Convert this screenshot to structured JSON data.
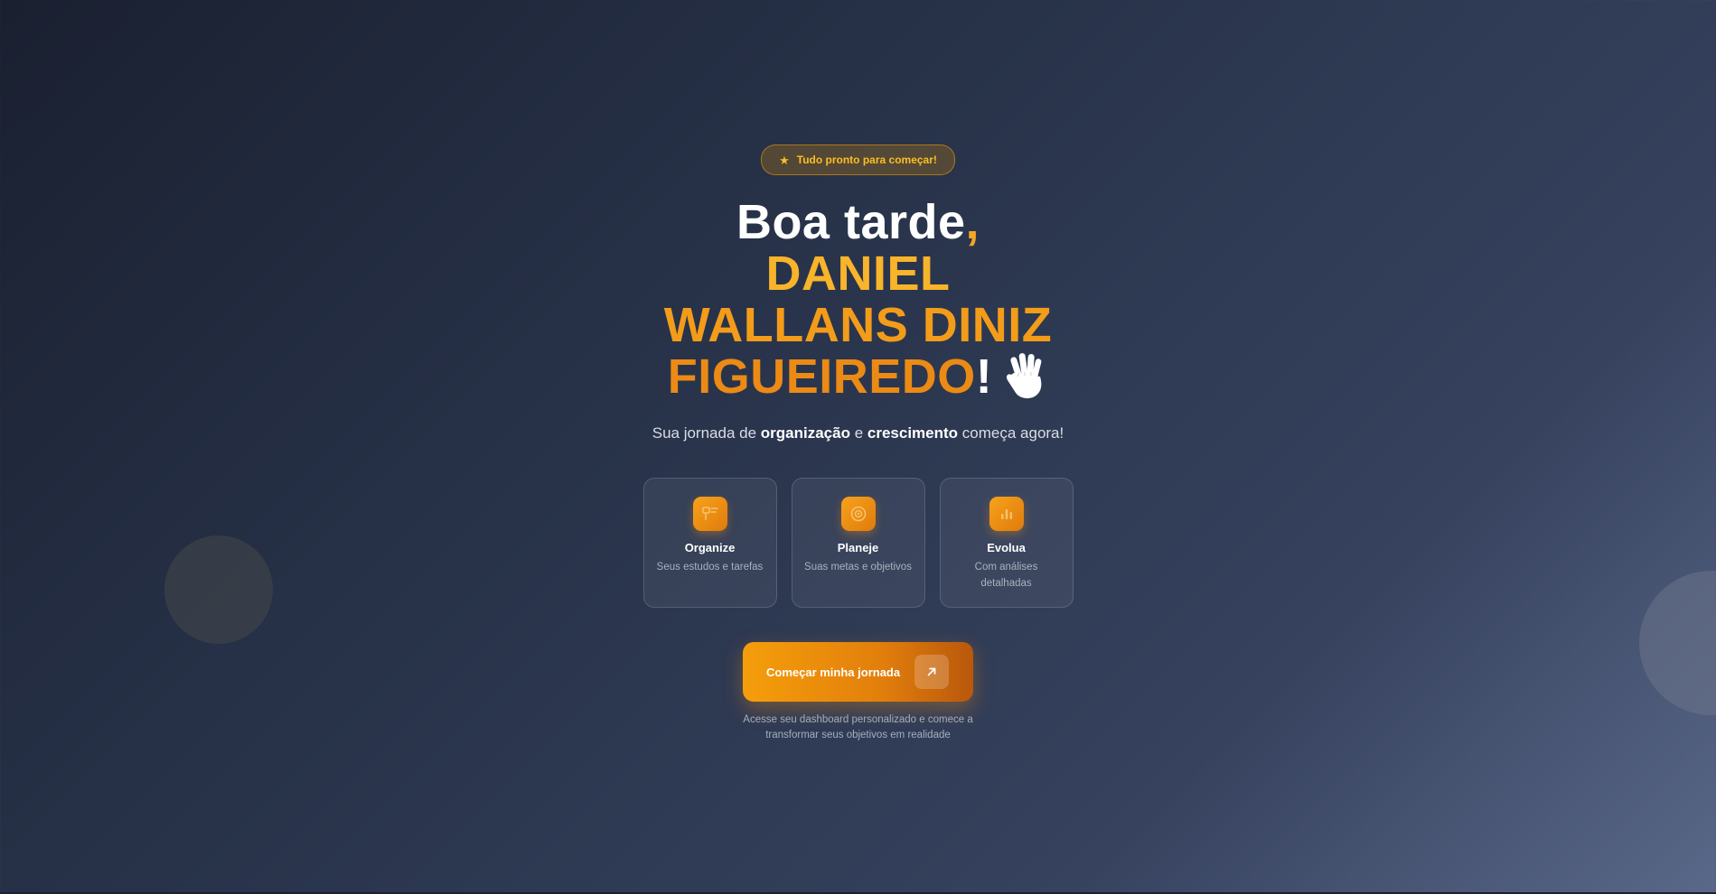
{
  "badge": {
    "icon": "star-icon",
    "text": "Tudo pronto para começar!"
  },
  "greeting": {
    "prefix": "Boa tarde",
    "comma": ",",
    "name_line_1": "DANIEL",
    "name_line_2": "WALLANS DINIZ",
    "name_line_3": "FIGUEIREDO",
    "exclamation": "!",
    "emoji_icon": "waving-hand-icon"
  },
  "subtitle": {
    "part1": "Sua jornada de ",
    "bold1": "organização",
    "part2": " e ",
    "bold2": "crescimento",
    "part3": " começa agora!"
  },
  "features": [
    {
      "icon": "organize-icon",
      "title": "Organize",
      "description": "Seus estudos e tarefas"
    },
    {
      "icon": "target-icon",
      "title": "Planeje",
      "description": "Suas metas e objetivos"
    },
    {
      "icon": "bar-chart-icon",
      "title": "Evolua",
      "description": "Com análises detalhadas"
    }
  ],
  "cta": {
    "label": "Começar minha jornada",
    "icon": "arrow-up-right-icon"
  },
  "footnote": "Acesse seu dashboard personalizado e comece a transformar seus objetivos em realidade",
  "colors": {
    "accent": "#f59e0b",
    "accent_dark": "#e07b0c",
    "badge_text": "#fbbf24"
  }
}
